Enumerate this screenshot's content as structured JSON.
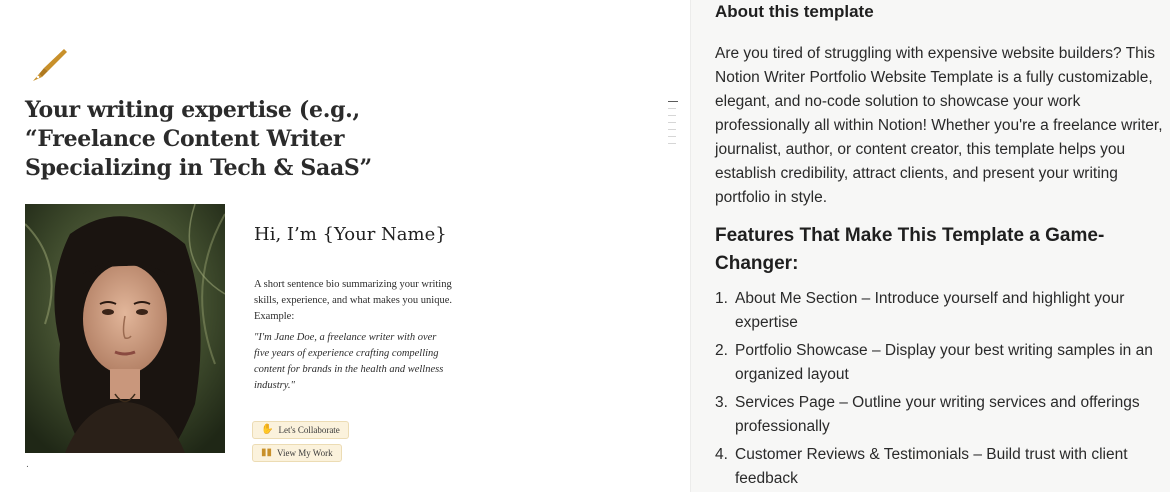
{
  "left_page": {
    "headline": "Your writing expertise (e.g., “Freelance Content Writer Specializing in Tech & SaaS”",
    "greeting": "Hi, I’m {Your Name}",
    "bio": "A short sentence bio summarizing your writing skills, experience, and what makes you unique. Example:",
    "quote": "\"I'm Jane Doe, a freelance writer with over five years of experience crafting compelling content for brands in the health and wellness industry.\"",
    "buttons": [
      {
        "icon": "wave-hand-icon",
        "label": "Let's Collaborate"
      },
      {
        "icon": "book-icon",
        "label": "View My Work"
      }
    ],
    "trailing_dot": "."
  },
  "right_panel": {
    "title": "About this template",
    "paragraph": "Are you tired of struggling with expensive website builders? This Notion Writer Portfolio Website Template is a fully customizable, elegant, and no-code solution to showcase your work professionally all within Notion! Whether you're a freelance writer, journalist, author, or content creator, this template helps you establish credibility, attract clients, and present your writing portfolio in style.",
    "features_heading": "Features That Make This Template a Game-Changer:",
    "features": [
      {
        "num": "1.",
        "text": "About Me Section – Introduce yourself and highlight your expertise"
      },
      {
        "num": "2.",
        "text": "Portfolio Showcase – Display your best writing samples in an organized layout"
      },
      {
        "num": "3.",
        "text": "Services Page – Outline your writing services and offerings professionally"
      },
      {
        "num": "4.",
        "text": "Customer Reviews & Testimonials – Build trust with client feedback"
      }
    ]
  },
  "colors": {
    "accent_gold": "#c8902a",
    "button_bg": "#fbf2dc",
    "panel_bg": "#f7f7f6"
  }
}
